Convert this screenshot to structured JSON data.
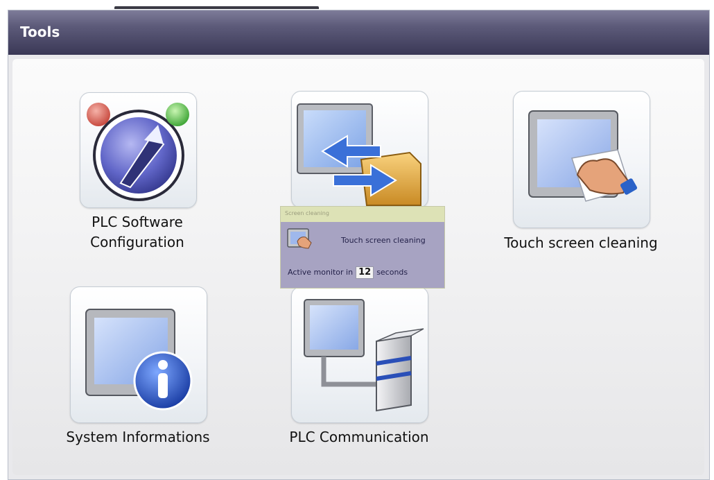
{
  "window": {
    "title": "Tools"
  },
  "tiles": [
    {
      "label_line1": "PLC Software",
      "label_line2": "Configuration",
      "icon": "plc-software-configuration-icon"
    },
    {
      "label": "",
      "icon": "file-transfer-icon"
    },
    {
      "label": "Touch screen cleaning",
      "icon": "touch-screen-cleaning-icon"
    },
    {
      "label": "System Informations",
      "icon": "system-information-icon"
    },
    {
      "label": "PLC Communication",
      "icon": "plc-communication-icon"
    }
  ],
  "popup": {
    "title": "Screen cleaning",
    "message": "Touch screen cleaning",
    "countdown_prefix": "Active monitor in",
    "countdown_value": "12",
    "countdown_suffix": "seconds"
  },
  "colors": {
    "titlebar": "#4a4868",
    "popup_body": "#a7a3c2",
    "popup_title": "#dde2b6"
  }
}
